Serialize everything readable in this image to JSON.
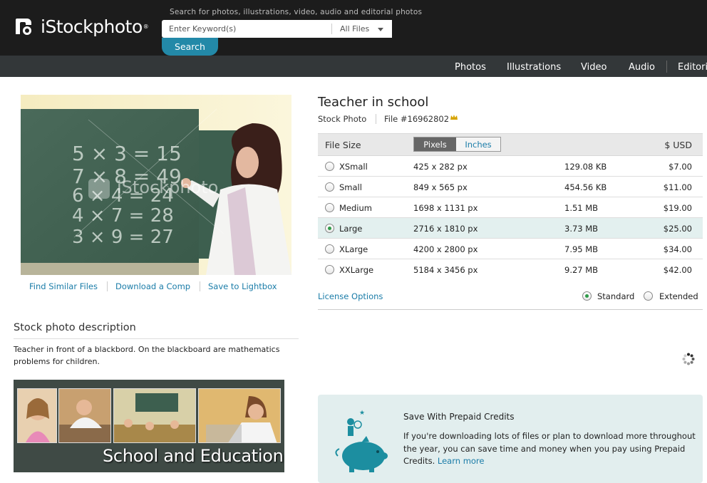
{
  "header": {
    "logo_text": "iStockphoto",
    "logo_reg": "®",
    "search_hint": "Search for photos, illustrations, video, audio and editorial photos",
    "search_placeholder": "Enter Keyword(s)",
    "search_filter": "All Files",
    "search_button": "Search"
  },
  "nav": [
    "Photos",
    "Illustrations",
    "Video",
    "Audio",
    "Editorial"
  ],
  "photo": {
    "watermark": "iStockphoto",
    "links": [
      "Find Similar Files",
      "Download a Comp",
      "Save to Lightbox"
    ]
  },
  "description": {
    "title": "Stock photo description",
    "text": "Teacher in front of a blackbord. On the blackboard are mathematics problems for children."
  },
  "banner": {
    "text": "School and Education"
  },
  "item": {
    "title": "Teacher in school",
    "type": "Stock Photo",
    "file_number": "File #16962802"
  },
  "size_table": {
    "header_file_size": "File Size",
    "toggle_pixels": "Pixels",
    "toggle_inches": "Inches",
    "header_price": "$ USD",
    "rows": [
      {
        "name": "XSmall",
        "dims": "425 x 282 px",
        "size": "129.08 KB",
        "price": "$7.00",
        "selected": false
      },
      {
        "name": "Small",
        "dims": "849 x 565 px",
        "size": "454.56 KB",
        "price": "$11.00",
        "selected": false
      },
      {
        "name": "Medium",
        "dims": "1698 x 1131 px",
        "size": "1.51 MB",
        "price": "$19.00",
        "selected": false
      },
      {
        "name": "Large",
        "dims": "2716 x 1810 px",
        "size": "3.73 MB",
        "price": "$25.00",
        "selected": true
      },
      {
        "name": "XLarge",
        "dims": "4200 x 2800 px",
        "size": "7.95 MB",
        "price": "$34.00",
        "selected": false
      },
      {
        "name": "XXLarge",
        "dims": "5184 x 3456 px",
        "size": "9.27 MB",
        "price": "$42.00",
        "selected": false
      }
    ]
  },
  "license": {
    "link": "License Options",
    "standard": "Standard",
    "extended": "Extended",
    "selected": "Standard"
  },
  "promo": {
    "title": "Save With Prepaid Credits",
    "text": "If you're downloading lots of files or plan to download more throughout the year, you can save time and money when you pay using Prepaid Credits.",
    "link": "Learn more"
  },
  "colors": {
    "link": "#1a7ca8",
    "search_button": "#2389a8",
    "selected_row": "#e3f0ef",
    "radio_on": "#2e9b49"
  }
}
